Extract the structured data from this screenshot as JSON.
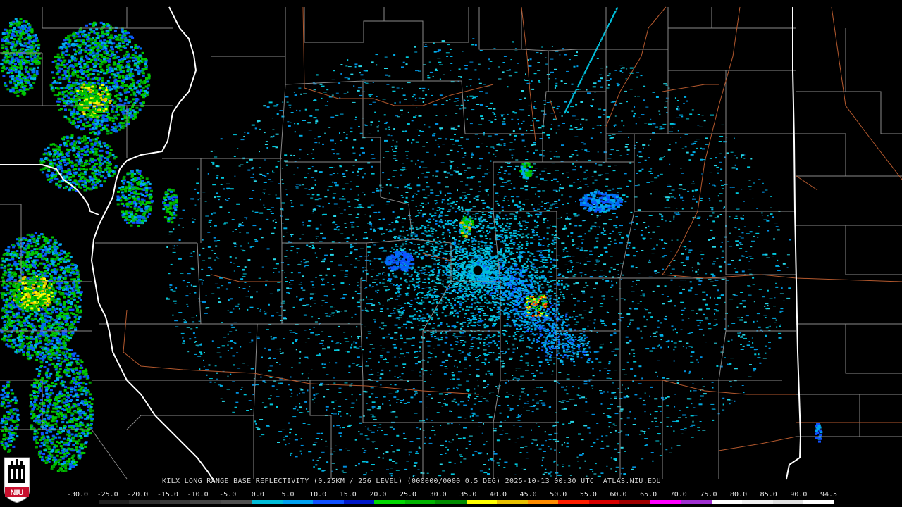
{
  "caption": "KILX LONG RANGE BASE REFLECTIVITY (0.25KM / 256 LEVEL) (000000/0000 0.5 DEG) 2025-10-13 00:30 UTC  ATLAS.NIU.EDU",
  "logo_text": "NIU",
  "scale": {
    "labels": [
      "-30.0",
      "-25.0",
      "-20.0",
      "-15.0",
      "-10.0",
      "-5.0",
      "0.0",
      "5.0",
      "10.0",
      "15.0",
      "20.0",
      "25.0",
      "30.0",
      "35.0",
      "40.0",
      "45.0",
      "50.0",
      "55.0",
      "60.0",
      "65.0",
      "70.0",
      "75.0",
      "80.0",
      "85.0",
      "90.0",
      "94.5"
    ],
    "colors": [
      "#000000",
      "#202020",
      "#303030",
      "#3a3a3a",
      "#454545",
      "#505050",
      "#00bcd8",
      "#00a0f0",
      "#1050ff",
      "#0018c8",
      "#00d800",
      "#00b400",
      "#008c00",
      "#ffff00",
      "#e8c000",
      "#ff8c00",
      "#ff1e00",
      "#d80000",
      "#a00000",
      "#ff00ff",
      "#a030d0",
      "#ffffff",
      "#f0f0f0",
      "#e0e0e0",
      "#ffffff"
    ]
  },
  "colors": {
    "state_border": "#ffffff",
    "county_border": "#8a8a8a",
    "highway": "#b4592e",
    "radar_site": "#000000"
  },
  "radar_site_icon": "radar-site-dot-icon",
  "logo_icon": "niu-shield-icon"
}
